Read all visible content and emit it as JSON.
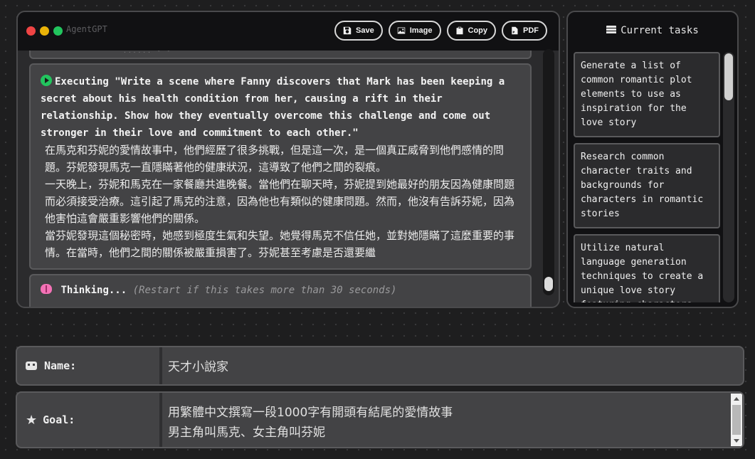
{
  "app": {
    "title": "AgentGPT"
  },
  "window_dots": {
    "colors": [
      "#ef4444",
      "#eab308",
      "#22c55e"
    ]
  },
  "toolbar": {
    "save_label": "Save",
    "image_label": "Image",
    "copy_label": "Copy",
    "pdf_label": "PDF"
  },
  "chat": {
    "previous_fragment": "...... -  -",
    "executing": {
      "heading": "Executing \"Write a scene where Fanny discovers that Mark has been keeping a secret about his health condition from her, causing a rift in their relationship. Show how they eventually overcome this challenge and come out stronger in their love and commitment to each other.\"",
      "body": "在馬克和芬妮的愛情故事中，他們經歷了很多挑戰，但是這一次，是一個真正威脅到他們感情的問題。芬妮發現馬克一直隱瞞著他的健康狀況，這導致了他們之間的裂痕。\n一天晚上，芬妮和馬克在一家餐廳共進晚餐。當他們在聊天時，芬妮提到她最好的朋友因為健康問題而必須接受治療。這引起了馬克的注意，因為他也有類似的健康問題。然而，他沒有告訴芬妮，因為他害怕這會嚴重影響他們的關係。\n當芬妮發現這個秘密時，她感到極度生氣和失望。她覺得馬克不信任她，並對她隱瞞了這麼重要的事情。在當時，他們之間的關係被嚴重損害了。芬妮甚至考慮是否還要繼"
    },
    "thinking": {
      "label": "Thinking...",
      "hint": "(Restart if this takes more than 30 seconds)"
    }
  },
  "tasks": {
    "title": "Current tasks",
    "items": [
      {
        "text": "Generate a list of common romantic plot elements to use as inspiration for the love story"
      },
      {
        "text": "Research common character traits and backgrounds for characters in romantic stories"
      },
      {
        "text": "Utilize natural language generation techniques to create a unique love story featuring characters named Mark"
      }
    ]
  },
  "form": {
    "name_label": "Name:",
    "name_value": "天才小說家",
    "goal_label": "Goal:",
    "goal_value": "用繁體中文撰寫一段1000字有開頭有結尾的愛情故事\n男主角叫馬克、女主角叫芬妮"
  }
}
